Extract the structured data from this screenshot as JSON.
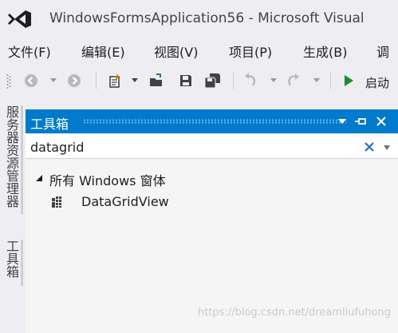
{
  "window": {
    "title": "WindowsFormsApplication56 - Microsoft Visual"
  },
  "menu": {
    "items": [
      {
        "label": "文件(F)"
      },
      {
        "label": "编辑(E)"
      },
      {
        "label": "视图(V)"
      },
      {
        "label": "项目(P)"
      },
      {
        "label": "生成(B)"
      },
      {
        "label": "调"
      }
    ]
  },
  "toolbar": {
    "start_label": "启动"
  },
  "side_tabs": {
    "server_explorer": "服务器资源管理器",
    "toolbox": "工具箱"
  },
  "toolbox": {
    "title": "工具箱",
    "search_value": "datagrid",
    "group_label": "所有 Windows 窗体",
    "items": [
      {
        "label": "DataGridView"
      }
    ]
  },
  "watermark": "https://blog.csdn.net/dreamliufuhong",
  "colors": {
    "accent": "#007acc",
    "chrome": "#eeeef2",
    "start_green": "#1f8b2c"
  }
}
